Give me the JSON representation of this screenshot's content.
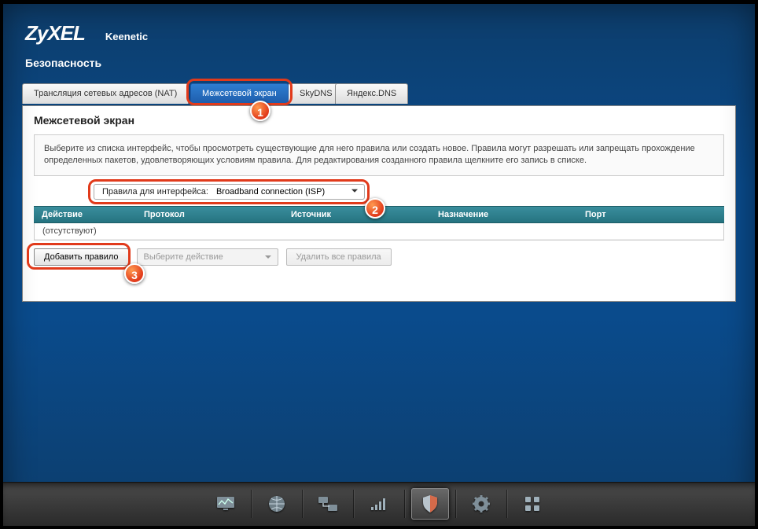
{
  "brand": {
    "logo": "ZyXEL",
    "model": "Keenetic"
  },
  "breadcrumb": "Безопасность",
  "tabs": {
    "nat": {
      "label": "Трансляция сетевых адресов (NAT)"
    },
    "fw": {
      "label": "Межсетевой экран"
    },
    "skydns": {
      "label": "SkyDNS"
    },
    "yadns": {
      "label": "Яндекс.DNS"
    }
  },
  "panel": {
    "title": "Межсетевой экран",
    "info": "Выберите из списка интерфейс, чтобы просмотреть существующие для него правила или создать новое. Правила могут разрешать или запрещать прохождение определенных пакетов, удовлетворяющих условиям правила. Для редактирования созданного правила щелкните его запись в списке.",
    "selector": {
      "label": "Правила для интерфейса:",
      "value": "Broadband connection (ISP)"
    },
    "columns": {
      "action": "Действие",
      "protocol": "Протокол",
      "source": "Источник",
      "destination": "Назначение",
      "port": "Порт"
    },
    "empty": "(отсутствуют)",
    "actions": {
      "add": "Добавить правило",
      "actionSelect": "Выберите действие",
      "deleteAll": "Удалить все правила"
    }
  },
  "annotations": {
    "one": "1",
    "two": "2",
    "three": "3"
  }
}
